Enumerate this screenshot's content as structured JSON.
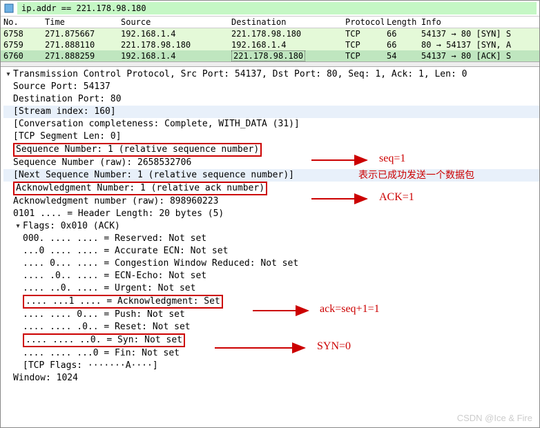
{
  "filter": {
    "value": "ip.addr == 221.178.98.180"
  },
  "columns": [
    "No.",
    "Time",
    "Source",
    "Destination",
    "Protocol",
    "Length",
    "Info"
  ],
  "packets": [
    {
      "no": "6758",
      "time": "271.875667",
      "src": "192.168.1.4",
      "dst": "221.178.98.180",
      "proto": "TCP",
      "len": "66",
      "info": "54137 → 80 [SYN] S"
    },
    {
      "no": "6759",
      "time": "271.888110",
      "src": "221.178.98.180",
      "dst": "192.168.1.4",
      "proto": "TCP",
      "len": "66",
      "info": "80 → 54137 [SYN, A"
    },
    {
      "no": "6760",
      "time": "271.888259",
      "src": "192.168.1.4",
      "dst": "221.178.98.180",
      "proto": "TCP",
      "len": "54",
      "info": "54137 → 80 [ACK] S"
    }
  ],
  "tree": {
    "title": "Transmission Control Protocol, Src Port: 54137, Dst Port: 80, Seq: 1, Ack: 1, Len: 0",
    "srcport": "Source Port: 54137",
    "dstport": "Destination Port: 80",
    "stream": "[Stream index: 160]",
    "conv": "[Conversation completeness: Complete, WITH_DATA (31)]",
    "seglen": "[TCP Segment Len: 0]",
    "seq": "Sequence Number: 1    (relative sequence number)",
    "seqraw": "Sequence Number (raw): 2658532706",
    "nextseq": "[Next Sequence Number: 1    (relative sequence number)]",
    "ack": "Acknowledgment Number: 1    (relative ack number)",
    "ackraw": "Acknowledgment number (raw): 898960223",
    "hlen": "0101 .... = Header Length: 20 bytes (5)",
    "flags_title": "Flags: 0x010 (ACK)",
    "flags": {
      "res": "000. .... .... = Reserved: Not set",
      "ae": "...0 .... .... = Accurate ECN: Not set",
      "cwr": ".... 0... .... = Congestion Window Reduced: Not set",
      "ece": ".... .0.. .... = ECN-Echo: Not set",
      "urg": ".... ..0. .... = Urgent: Not set",
      "ackf": ".... ...1 .... = Acknowledgment: Set",
      "psh": ".... .... 0... = Push: Not set",
      "rst": ".... .... .0.. = Reset: Not set",
      "syn": ".... .... ..0. = Syn: Not set",
      "fin": ".... .... ...0 = Fin: Not set",
      "str": "[TCP Flags: ·······A····]"
    },
    "window": "Window: 1024"
  },
  "annotations": {
    "seq_label": "seq=1",
    "seq_note": "表示已成功发送一个数据包",
    "ack_label": "ACK=1",
    "ackf_label": "ack=seq+1=1",
    "syn_label": "SYN=0"
  },
  "watermark": "CSDN @Ice & Fire"
}
